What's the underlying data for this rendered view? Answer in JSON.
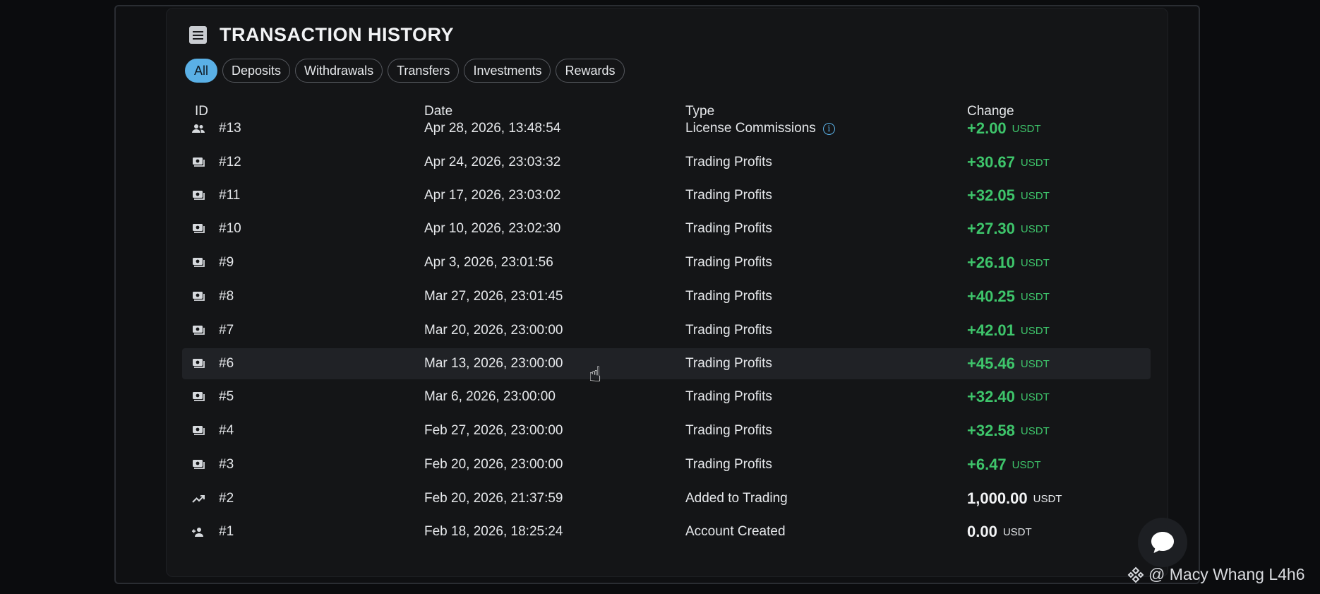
{
  "header": {
    "title": "TRANSACTION HISTORY"
  },
  "filters": [
    {
      "label": "All",
      "active": true
    },
    {
      "label": "Deposits",
      "active": false
    },
    {
      "label": "Withdrawals",
      "active": false
    },
    {
      "label": "Transfers",
      "active": false
    },
    {
      "label": "Investments",
      "active": false
    },
    {
      "label": "Rewards",
      "active": false
    }
  ],
  "table": {
    "columns": {
      "id": "ID",
      "date": "Date",
      "type": "Type",
      "change": "Change"
    },
    "rows": [
      {
        "icon": "users-icon",
        "id": "#13",
        "date": "Apr 28, 2026, 13:48:54",
        "type": "License Commissions",
        "info": true,
        "amount": "+2.00",
        "unit": "USDT",
        "tone": "pos"
      },
      {
        "icon": "cash-icon",
        "id": "#12",
        "date": "Apr 24, 2026, 23:03:32",
        "type": "Trading Profits",
        "amount": "+30.67",
        "unit": "USDT",
        "tone": "pos"
      },
      {
        "icon": "cash-icon",
        "id": "#11",
        "date": "Apr 17, 2026, 23:03:02",
        "type": "Trading Profits",
        "amount": "+32.05",
        "unit": "USDT",
        "tone": "pos"
      },
      {
        "icon": "cash-icon",
        "id": "#10",
        "date": "Apr 10, 2026, 23:02:30",
        "type": "Trading Profits",
        "amount": "+27.30",
        "unit": "USDT",
        "tone": "pos"
      },
      {
        "icon": "cash-icon",
        "id": "#9",
        "date": "Apr 3, 2026, 23:01:56",
        "type": "Trading Profits",
        "amount": "+26.10",
        "unit": "USDT",
        "tone": "pos"
      },
      {
        "icon": "cash-icon",
        "id": "#8",
        "date": "Mar 27, 2026, 23:01:45",
        "type": "Trading Profits",
        "amount": "+40.25",
        "unit": "USDT",
        "tone": "pos"
      },
      {
        "icon": "cash-icon",
        "id": "#7",
        "date": "Mar 20, 2026, 23:00:00",
        "type": "Trading Profits",
        "amount": "+42.01",
        "unit": "USDT",
        "tone": "pos"
      },
      {
        "icon": "cash-icon",
        "id": "#6",
        "date": "Mar 13, 2026, 23:00:00",
        "type": "Trading Profits",
        "amount": "+45.46",
        "unit": "USDT",
        "tone": "pos",
        "hover": true
      },
      {
        "icon": "cash-icon",
        "id": "#5",
        "date": "Mar 6, 2026, 23:00:00",
        "type": "Trading Profits",
        "amount": "+32.40",
        "unit": "USDT",
        "tone": "pos"
      },
      {
        "icon": "cash-icon",
        "id": "#4",
        "date": "Feb 27, 2026, 23:00:00",
        "type": "Trading Profits",
        "amount": "+32.58",
        "unit": "USDT",
        "tone": "pos"
      },
      {
        "icon": "cash-icon",
        "id": "#3",
        "date": "Feb 20, 2026, 23:00:00",
        "type": "Trading Profits",
        "amount": "+6.47",
        "unit": "USDT",
        "tone": "pos"
      },
      {
        "icon": "trending-up-icon",
        "id": "#2",
        "date": "Feb 20, 2026, 21:37:59",
        "type": "Added to Trading",
        "amount": "1,000.00",
        "unit": "USDT",
        "tone": "neutral"
      },
      {
        "icon": "user-add-icon",
        "id": "#1",
        "date": "Feb 18, 2026, 18:25:24",
        "type": "Account Created",
        "amount": "0.00",
        "unit": "USDT",
        "tone": "neutral"
      }
    ]
  },
  "watermark": {
    "text": "@ Macy Whang L4h6"
  },
  "colors": {
    "accent": "#5ab0e6",
    "positive": "#3ec56b",
    "background": "#141517"
  }
}
